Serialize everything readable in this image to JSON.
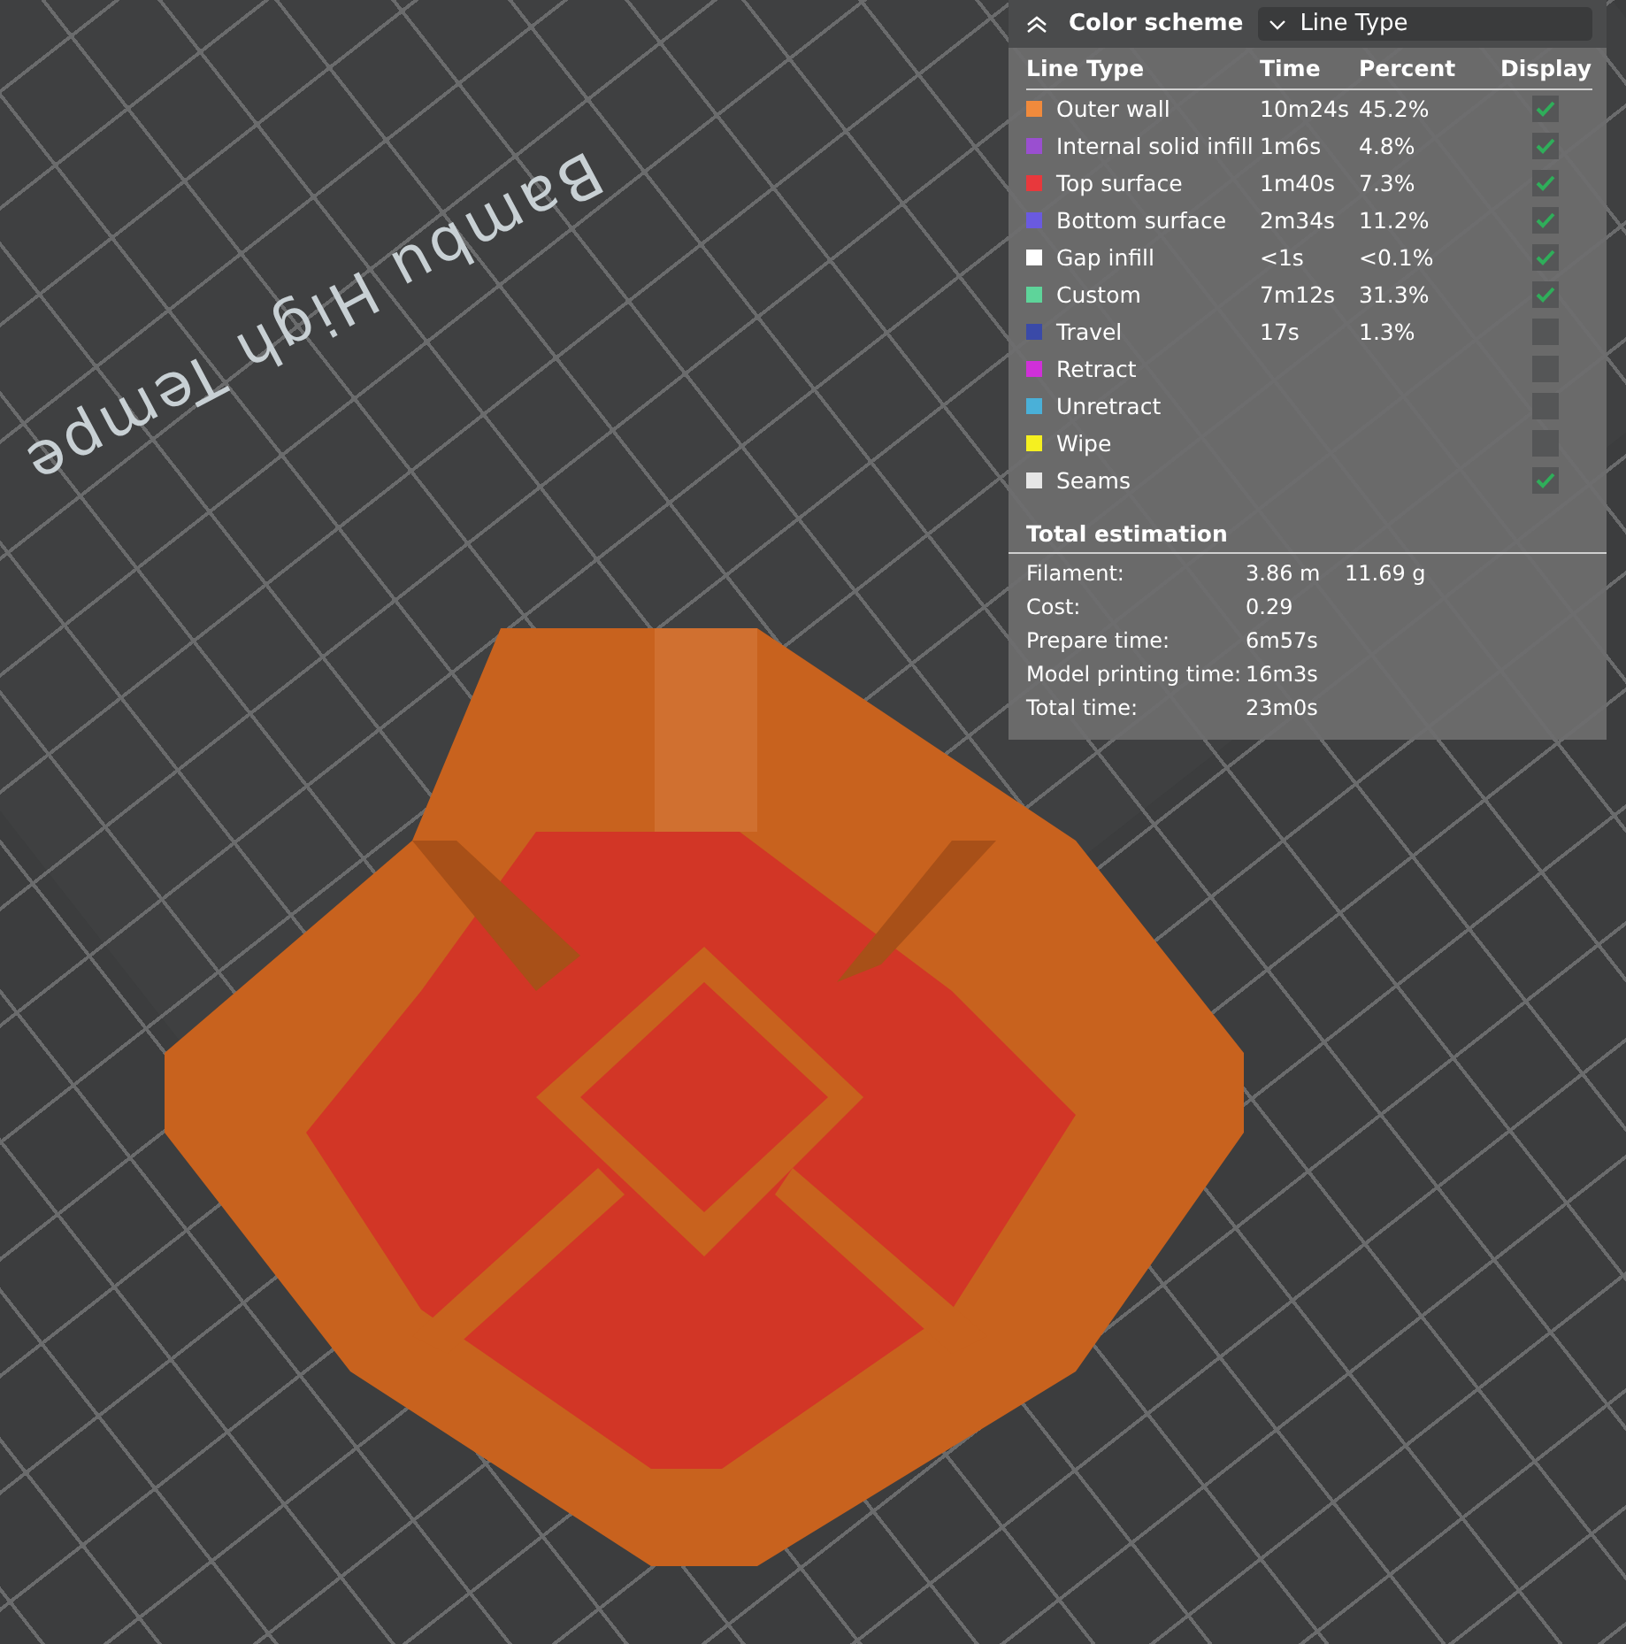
{
  "bed_label": "Bambu High Tempe",
  "legend": {
    "title": "Color scheme",
    "scheme_value": "Line Type",
    "columns": [
      "Line Type",
      "Time",
      "Percent",
      "Display"
    ],
    "rows": [
      {
        "name": "Outer wall",
        "time": "10m24s",
        "percent": "45.2%",
        "color": "#f08a3c",
        "display": true
      },
      {
        "name": "Internal solid infill",
        "time": "1m6s",
        "percent": "4.8%",
        "color": "#9a4fd0",
        "display": true
      },
      {
        "name": "Top surface",
        "time": "1m40s",
        "percent": "7.3%",
        "color": "#e8383c",
        "display": true
      },
      {
        "name": "Bottom surface",
        "time": "2m34s",
        "percent": "11.2%",
        "color": "#6a5ae0",
        "display": true
      },
      {
        "name": "Gap infill",
        "time": "<1s",
        "percent": "<0.1%",
        "color": "#ffffff",
        "display": true
      },
      {
        "name": "Custom",
        "time": "7m12s",
        "percent": "31.3%",
        "color": "#5ed49a",
        "display": true
      },
      {
        "name": "Travel",
        "time": "17s",
        "percent": "1.3%",
        "color": "#3a4aa8",
        "display": false
      },
      {
        "name": "Retract",
        "color": "#d030d8",
        "display": false
      },
      {
        "name": "Unretract",
        "color": "#4ab0d8",
        "display": false
      },
      {
        "name": "Wipe",
        "color": "#f5f020",
        "display": false
      },
      {
        "name": "Seams",
        "color": "#e6e6e6",
        "display": true
      }
    ],
    "total_title": "Total estimation",
    "totals": [
      {
        "label": "Filament:",
        "value": "3.86 m",
        "extra": "11.69 g"
      },
      {
        "label": "Cost:",
        "value": "0.29"
      },
      {
        "label": "Prepare time:",
        "value": "6m57s"
      },
      {
        "label": "Model printing time:",
        "value": "16m3s"
      },
      {
        "label": "Total time:",
        "value": "23m0s"
      }
    ]
  }
}
